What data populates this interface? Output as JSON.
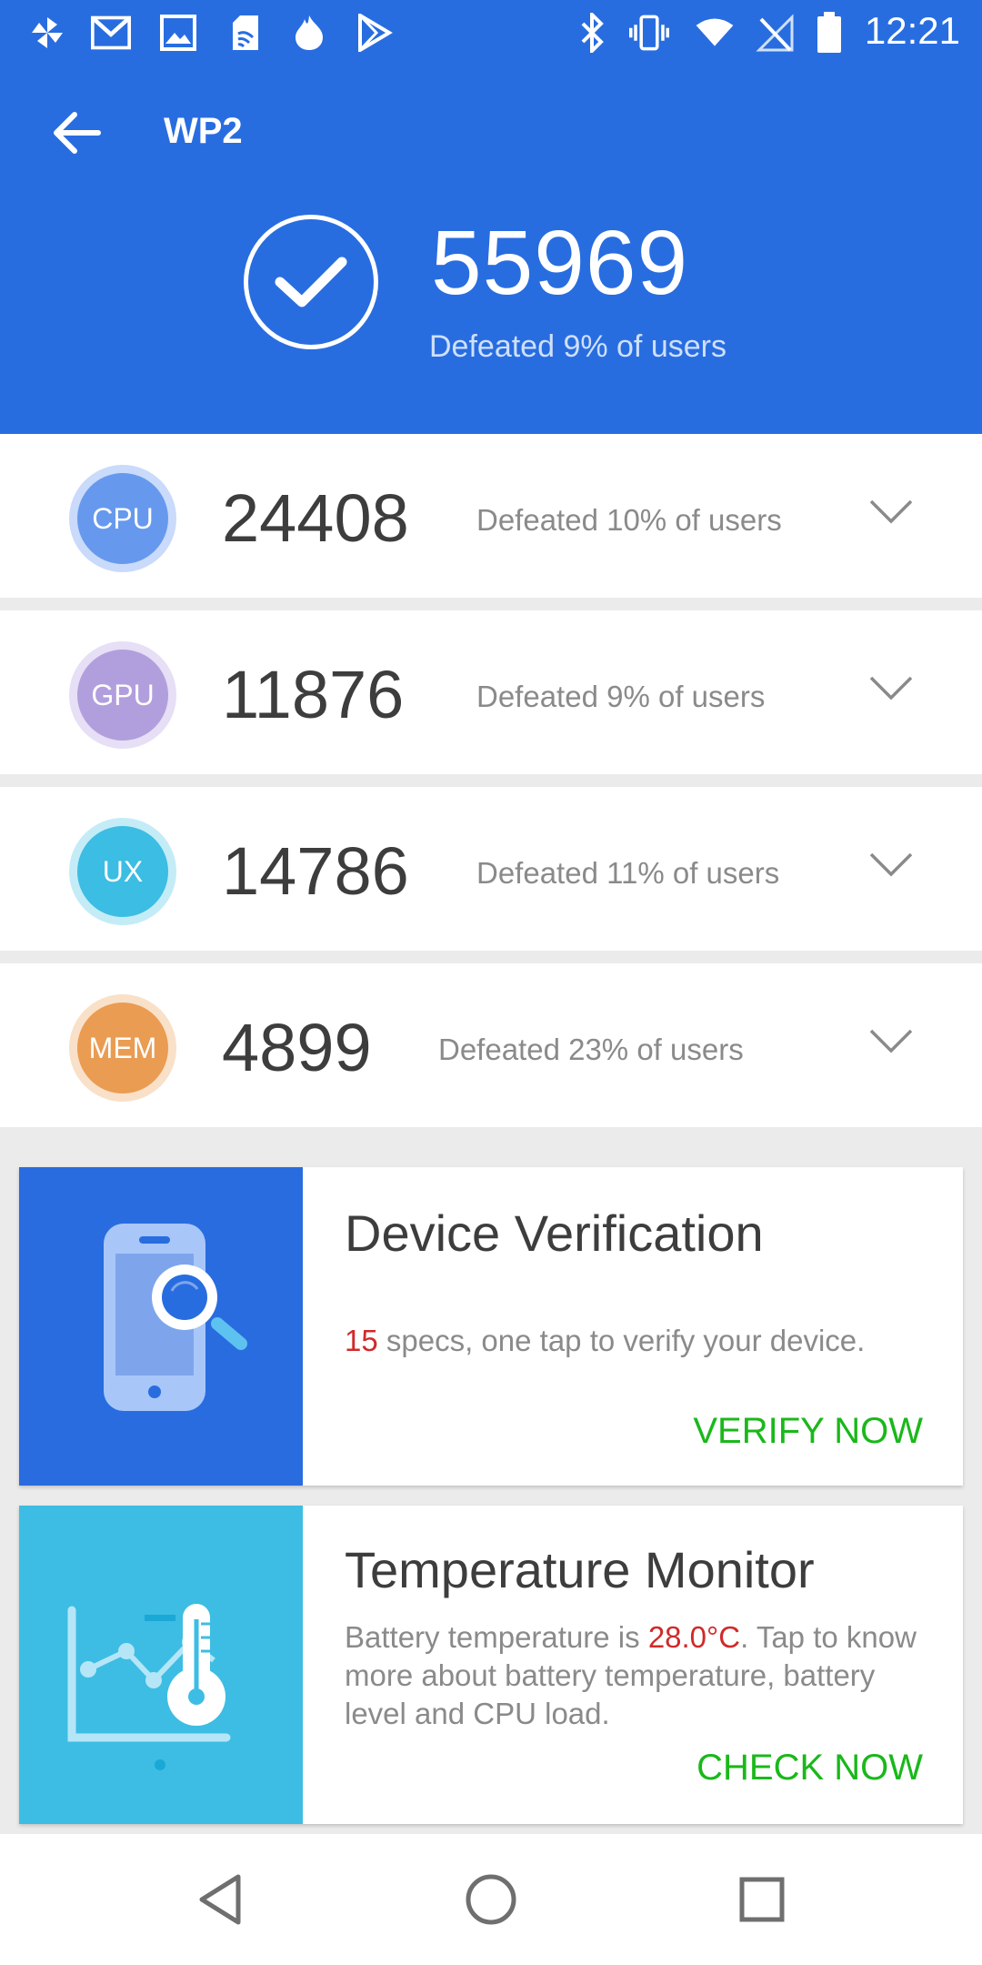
{
  "status_bar": {
    "time": "12:21",
    "left_icons": [
      "pinwheel-icon",
      "gmail-icon",
      "photos-icon",
      "sim-card-icon",
      "flame-icon",
      "play-store-icon"
    ],
    "right_icons": [
      "bluetooth-icon",
      "vibrate-icon",
      "wifi-icon",
      "no-signal-icon",
      "battery-icon"
    ]
  },
  "header": {
    "title": "WP2",
    "total_score": "55969",
    "total_defeated": "Defeated 9% of users",
    "background_color": "#286de0"
  },
  "scores": [
    {
      "label": "CPU",
      "score": "24408",
      "defeated": "Defeated 10% of users",
      "color": "#6699ee",
      "ring": "#c9dafa"
    },
    {
      "label": "GPU",
      "score": "11876",
      "defeated": "Defeated 9% of users",
      "color": "#b19fdd",
      "ring": "#e6dff5"
    },
    {
      "label": "UX",
      "score": "14786",
      "defeated": "Defeated 11% of users",
      "color": "#3cbde3",
      "ring": "#c4ecf7"
    },
    {
      "label": "MEM",
      "score": "4899",
      "defeated": "Defeated 23% of users",
      "color": "#ea9c52",
      "ring": "#f9e0c8"
    }
  ],
  "device_verification": {
    "title": "Device Verification",
    "count": "15",
    "desc_rest": " specs, one tap to verify your device.",
    "action": "VERIFY NOW",
    "panel_color": "#296ce0"
  },
  "temperature_monitor": {
    "title": "Temperature Monitor",
    "desc_prefix": "Battery temperature is ",
    "temperature": "28.0°C",
    "desc_suffix": ". Tap to know more about battery temperature, battery level and CPU load.",
    "action": "CHECK NOW",
    "panel_color": "#3dbde3"
  },
  "nav": {
    "icons": [
      "back-triangle-icon",
      "home-circle-icon",
      "recents-square-icon"
    ]
  }
}
